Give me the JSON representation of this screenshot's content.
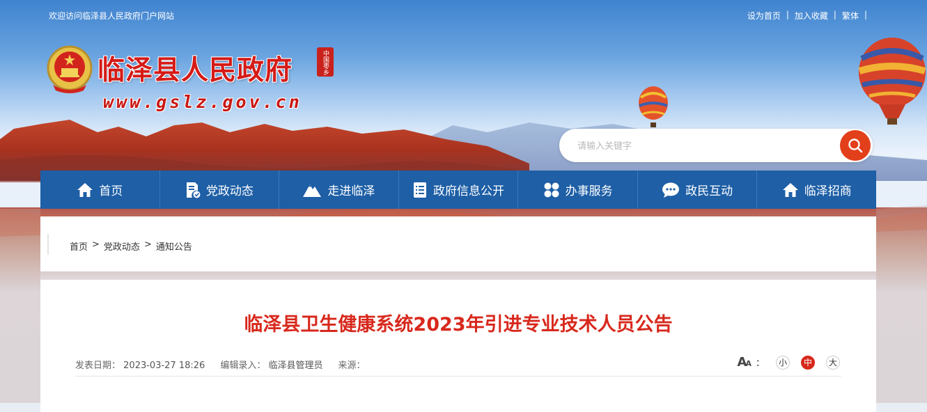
{
  "topbar": {
    "welcome": "欢迎访问临泽县人民政府门户网站",
    "links": [
      "设为首页",
      "加入收藏",
      "繁体"
    ]
  },
  "header": {
    "site_title": "临泽县人民政府",
    "seal_text": "中国枣乡",
    "url": "www.gslz.gov.cn"
  },
  "search": {
    "placeholder": "请输入关键字"
  },
  "nav": [
    {
      "label": "首页",
      "icon": "home-icon"
    },
    {
      "label": "党政动态",
      "icon": "document-check-icon"
    },
    {
      "label": "走进临泽",
      "icon": "mountain-icon"
    },
    {
      "label": "政府信息公开",
      "icon": "list-document-icon"
    },
    {
      "label": "办事服务",
      "icon": "grid-icon"
    },
    {
      "label": "政民互动",
      "icon": "chat-icon"
    },
    {
      "label": "临泽招商",
      "icon": "home-icon"
    }
  ],
  "breadcrumb": {
    "items": [
      "首页",
      "党政动态",
      "通知公告"
    ],
    "separator": ">"
  },
  "article": {
    "title": "临泽县卫生健康系统2023年引进专业技术人员公告",
    "date_label": "发表日期：",
    "date": "2023-03-27 18:26",
    "editor_label": "编辑录入：",
    "editor": "临泽县管理员",
    "source_label": "来源：",
    "source": "",
    "font_size": {
      "label": "：",
      "options": [
        "小",
        "中",
        "大"
      ],
      "selected": "中"
    }
  },
  "colors": {
    "nav_bg": "#1e5fa6",
    "accent_red": "#d8281c",
    "search_btn": "#e2401b"
  }
}
